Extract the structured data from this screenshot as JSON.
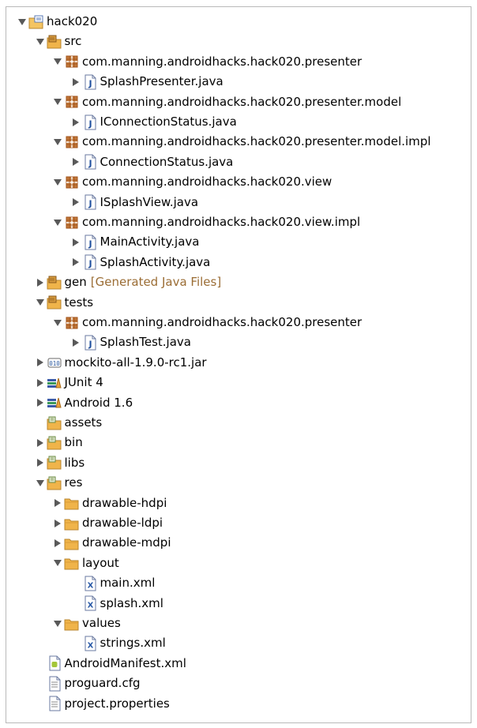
{
  "colors": {
    "accent_package": "#a0521b",
    "folder": "#f0b44a",
    "decoration": "#9b6d35",
    "border": "#b9b9b9"
  },
  "tree": [
    {
      "label": "hack020",
      "icon": "project-icon",
      "level": 0,
      "twisty": "expanded"
    },
    {
      "label": "src",
      "icon": "source-folder-icon",
      "level": 1,
      "twisty": "expanded"
    },
    {
      "label": "com.manning.androidhacks.hack020.presenter",
      "icon": "package-icon",
      "level": 2,
      "twisty": "expanded"
    },
    {
      "label": "SplashPresenter.java",
      "icon": "java-file-icon",
      "level": 3,
      "twisty": "collapsed"
    },
    {
      "label": "com.manning.androidhacks.hack020.presenter.model",
      "icon": "package-icon",
      "level": 2,
      "twisty": "expanded"
    },
    {
      "label": "IConnectionStatus.java",
      "icon": "java-file-icon",
      "level": 3,
      "twisty": "collapsed"
    },
    {
      "label": "com.manning.androidhacks.hack020.presenter.model.impl",
      "icon": "package-icon",
      "level": 2,
      "twisty": "expanded"
    },
    {
      "label": "ConnectionStatus.java",
      "icon": "java-file-icon",
      "level": 3,
      "twisty": "collapsed"
    },
    {
      "label": "com.manning.androidhacks.hack020.view",
      "icon": "package-icon",
      "level": 2,
      "twisty": "expanded"
    },
    {
      "label": "ISplashView.java",
      "icon": "java-file-icon",
      "level": 3,
      "twisty": "collapsed"
    },
    {
      "label": "com.manning.androidhacks.hack020.view.impl",
      "icon": "package-icon",
      "level": 2,
      "twisty": "expanded"
    },
    {
      "label": "MainActivity.java",
      "icon": "java-file-icon",
      "level": 3,
      "twisty": "collapsed"
    },
    {
      "label": "SplashActivity.java",
      "icon": "java-file-icon",
      "level": 3,
      "twisty": "collapsed"
    },
    {
      "label": "gen",
      "decoration": "[Generated Java Files]",
      "icon": "source-folder-icon",
      "level": 1,
      "twisty": "collapsed"
    },
    {
      "label": "tests",
      "icon": "source-folder-icon",
      "level": 1,
      "twisty": "expanded"
    },
    {
      "label": "com.manning.androidhacks.hack020.presenter",
      "icon": "package-icon",
      "level": 2,
      "twisty": "expanded"
    },
    {
      "label": "SplashTest.java",
      "icon": "java-file-icon",
      "level": 3,
      "twisty": "collapsed"
    },
    {
      "label": "mockito-all-1.9.0-rc1.jar",
      "icon": "jar-icon",
      "level": 1,
      "twisty": "collapsed"
    },
    {
      "label": "JUnit 4",
      "icon": "library-icon",
      "level": 1,
      "twisty": "collapsed"
    },
    {
      "label": "Android 1.6",
      "icon": "library-icon",
      "level": 1,
      "twisty": "collapsed"
    },
    {
      "label": "assets",
      "icon": "resource-folder-icon",
      "level": 1,
      "twisty": "none"
    },
    {
      "label": "bin",
      "icon": "resource-folder-icon",
      "level": 1,
      "twisty": "collapsed"
    },
    {
      "label": "libs",
      "icon": "resource-folder-icon",
      "level": 1,
      "twisty": "collapsed"
    },
    {
      "label": "res",
      "icon": "resource-folder-icon",
      "level": 1,
      "twisty": "expanded"
    },
    {
      "label": "drawable-hdpi",
      "icon": "folder-icon",
      "level": 2,
      "twisty": "collapsed"
    },
    {
      "label": "drawable-ldpi",
      "icon": "folder-icon",
      "level": 2,
      "twisty": "collapsed"
    },
    {
      "label": "drawable-mdpi",
      "icon": "folder-icon",
      "level": 2,
      "twisty": "collapsed"
    },
    {
      "label": "layout",
      "icon": "folder-icon",
      "level": 2,
      "twisty": "expanded"
    },
    {
      "label": "main.xml",
      "icon": "xml-file-icon",
      "level": 3,
      "twisty": "none"
    },
    {
      "label": "splash.xml",
      "icon": "xml-file-icon",
      "level": 3,
      "twisty": "none"
    },
    {
      "label": "values",
      "icon": "folder-icon",
      "level": 2,
      "twisty": "expanded"
    },
    {
      "label": "strings.xml",
      "icon": "xml-file-icon",
      "level": 3,
      "twisty": "none"
    },
    {
      "label": "AndroidManifest.xml",
      "icon": "android-manifest-icon",
      "level": 1,
      "twisty": "none"
    },
    {
      "label": "proguard.cfg",
      "icon": "text-file-icon",
      "level": 1,
      "twisty": "none"
    },
    {
      "label": "project.properties",
      "icon": "text-file-icon",
      "level": 1,
      "twisty": "none"
    }
  ]
}
